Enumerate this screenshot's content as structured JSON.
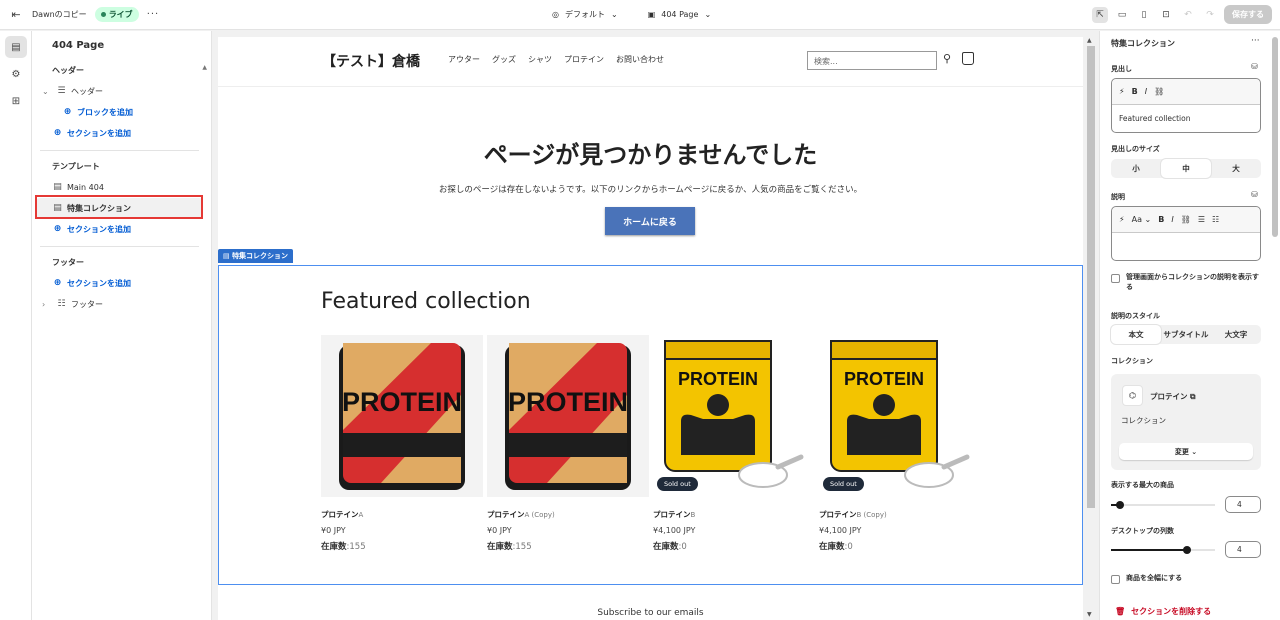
{
  "topbar": {
    "store_name": "Dawnのコピー",
    "status": "ライブ",
    "theme_selector": "デフォルト",
    "page_selector": "404 Page",
    "save_label": "保存する"
  },
  "left_panel": {
    "page_title": "404 Page",
    "groups": {
      "header": {
        "heading": "ヘッダー",
        "section_label": "ヘッダー",
        "add_block": "ブロックを追加",
        "add_section": "セクションを追加"
      },
      "template": {
        "heading": "テンプレート",
        "items": [
          "Main 404",
          "特集コレクション"
        ],
        "add_section": "セクションを追加"
      },
      "footer": {
        "heading": "フッター",
        "add_section": "セクションを追加",
        "section_label": "フッター"
      }
    }
  },
  "preview": {
    "store_logo": "【テスト】倉橋",
    "nav": [
      "アウター",
      "グッズ",
      "シャツ",
      "プロテイン",
      "お問い合わせ"
    ],
    "search_placeholder": "検索...",
    "not_found_title": "ページが見つかりませんでした",
    "not_found_desc": "お探しのページは存在しないようです。以下のリンクからホームページに戻るか、人気の商品をご覧ください。",
    "home_button": "ホームに戻る",
    "section_tag": "特集コレクション",
    "collection_heading": "Featured collection",
    "products": [
      {
        "name": "プロテイン",
        "suffix": "A",
        "price": "¥0 JPY",
        "stock_label": "在庫数",
        "stock": ":155",
        "sold_out": "",
        "style": "red"
      },
      {
        "name": "プロテイン",
        "suffix": "A (Copy)",
        "price": "¥0 JPY",
        "stock_label": "在庫数",
        "stock": ":155",
        "sold_out": "",
        "style": "red"
      },
      {
        "name": "プロテイン",
        "suffix": "B",
        "price": "¥4,100 JPY",
        "stock_label": "在庫数",
        "stock": ":0",
        "sold_out": "Sold out",
        "style": "yellow"
      },
      {
        "name": "プロテイン",
        "suffix": "B (Copy)",
        "price": "¥4,100 JPY",
        "stock_label": "在庫数",
        "stock": ":0",
        "sold_out": "Sold out",
        "style": "yellow"
      }
    ],
    "product_label_text": "PROTEIN",
    "subscribe": "Subscribe to our emails"
  },
  "right_panel": {
    "title": "特集コレクション",
    "heading_label": "見出し",
    "heading_value": "Featured collection",
    "heading_size_label": "見出しのサイズ",
    "heading_sizes": [
      "小",
      "中",
      "大"
    ],
    "heading_size_selected": 1,
    "description_label": "説明",
    "font_tool": "Aa",
    "show_admin_desc": "管理画面からコレクションの説明を表示する",
    "desc_style_label": "説明のスタイル",
    "desc_styles": [
      "本文",
      "サブタイトル",
      "大文字"
    ],
    "desc_style_selected": 0,
    "collection_label": "コレクション",
    "collection_name": "プロテイン",
    "collection_type": "コレクション",
    "change_button": "変更",
    "max_products_label": "表示する最大の商品",
    "max_products": "4",
    "max_products_fraction": 0.09,
    "desktop_columns_label": "デスクトップの列数",
    "desktop_columns": "4",
    "desktop_columns_fraction": 0.73,
    "full_width_label": "商品を全幅にする",
    "delete_section": "セクションを削除する"
  },
  "colors": {
    "accent": "#005bd3",
    "selection_frame": "#4d8ff0",
    "home_button": "#4a73b9",
    "highlight_box": "#e53935",
    "delete": "#c70a24"
  }
}
